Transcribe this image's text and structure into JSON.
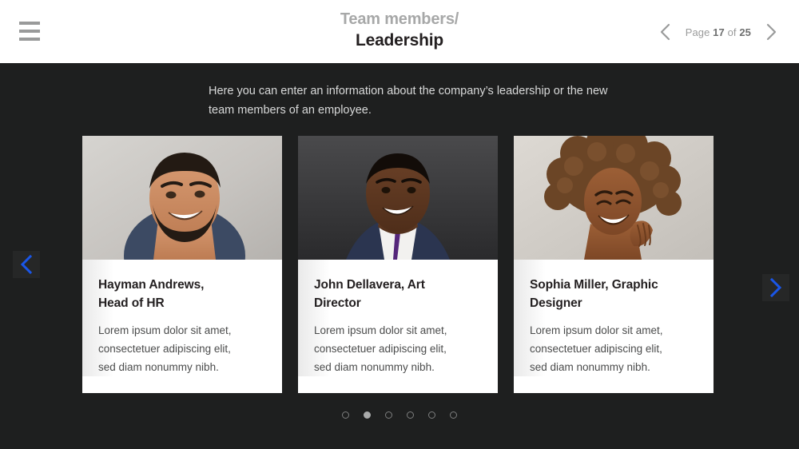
{
  "header": {
    "menu_icon": "hamburger-menu-icon",
    "title_sub": "Team members/",
    "title_main": "Leadership",
    "pager": {
      "prev_icon": "chevron-left-icon",
      "next_icon": "chevron-right-icon",
      "prefix": "Page",
      "current": "17",
      "middle": "of",
      "total": "25"
    }
  },
  "main": {
    "intro_line1": "Here you can enter an information about the company’s leadership or",
    "intro_line2": "the new team members of an employee.",
    "cards": [
      {
        "name": "Hayman Andrews,",
        "role": "Head of HR",
        "desc_line1": "Lorem ipsum dolor sit amet,",
        "desc_line2": "consectetuer adipiscing elit,",
        "desc_line3": "sed diam nonummy nibh.",
        "photo_alt": "portrait-smiling-man-beard"
      },
      {
        "name": "John Dellavera, Art",
        "role": "Director",
        "desc_line1": "Lorem ipsum dolor sit amet,",
        "desc_line2": "consectetuer adipiscing elit,",
        "desc_line3": "sed diam nonummy nibh.",
        "photo_alt": "portrait-smiling-man-suit"
      },
      {
        "name": "Sophia Miller, Graphic",
        "role": "Designer",
        "desc_line1": "Lorem ipsum dolor sit amet,",
        "desc_line2": "consectetuer adipiscing elit,",
        "desc_line3": "sed diam nonummy nibh.",
        "photo_alt": "portrait-laughing-woman-curly-hair"
      }
    ],
    "carousel": {
      "prev_icon": "chevron-left-icon",
      "next_icon": "chevron-right-icon",
      "dot_count": 6,
      "active_dot": 2
    }
  },
  "colors": {
    "background": "#1e1f1f",
    "header_background": "#ffffff",
    "accent_blue": "#1a56e8",
    "card_background": "#ffffff",
    "title_muted": "#a7a8a8",
    "title_strong": "#231f20",
    "body_text": "#d8d9d9"
  }
}
